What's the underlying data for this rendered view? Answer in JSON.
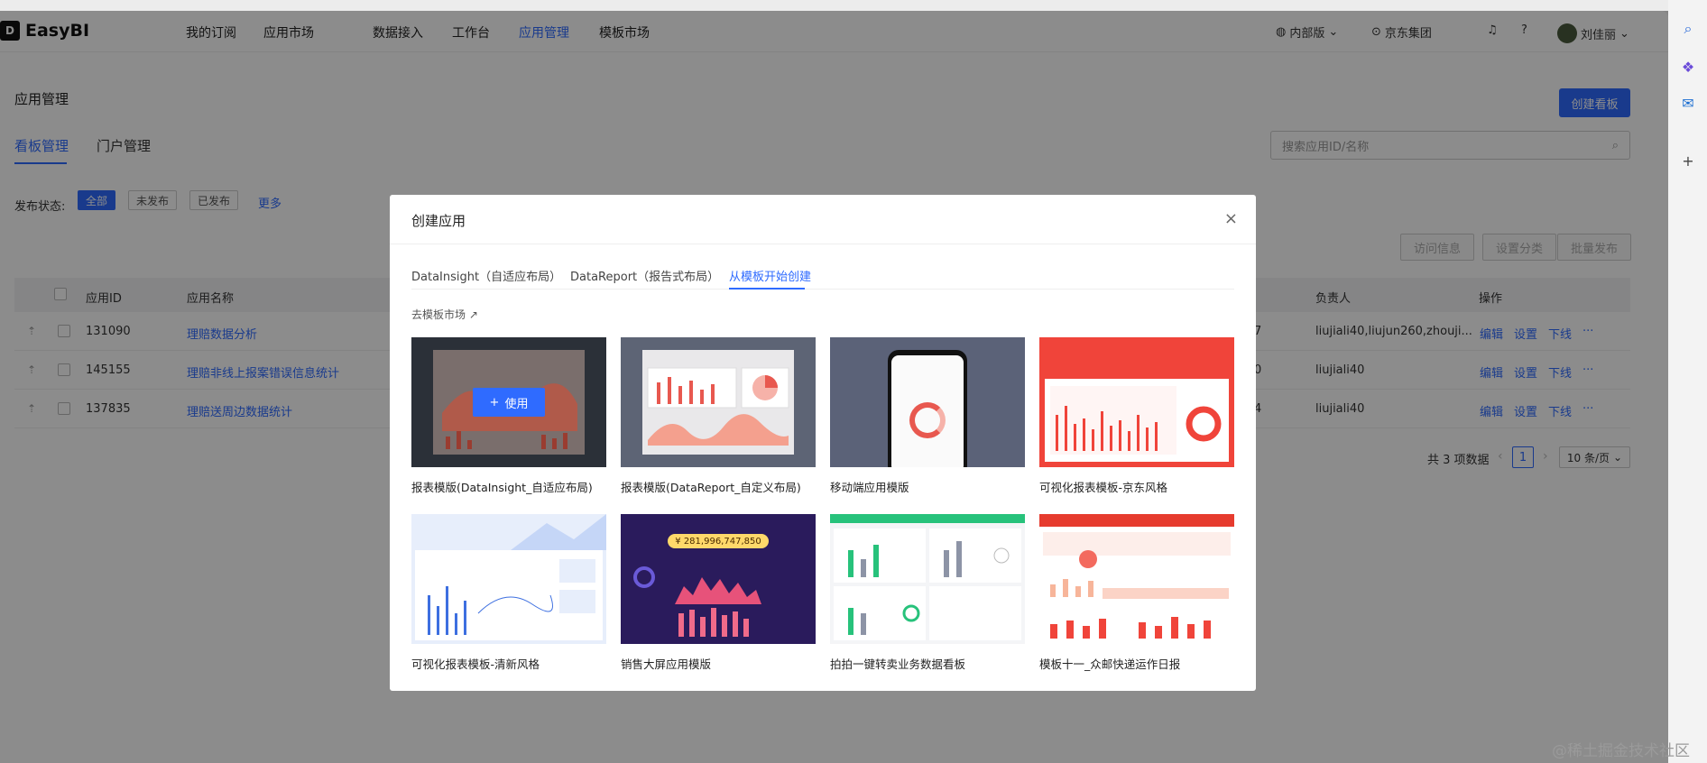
{
  "brand": "EasyBI",
  "nav": {
    "items": [
      "我的订阅",
      "应用市场",
      "数据接入",
      "工作台",
      "应用管理",
      "模板市场"
    ],
    "active": "应用管理",
    "edition": "内部版",
    "org": "京东集团",
    "user": "刘佳丽"
  },
  "page": {
    "title": "应用管理",
    "create_button": "创建看板",
    "tabs": [
      "看板管理",
      "门户管理"
    ],
    "search_placeholder": "搜索应用ID/名称",
    "filter_label": "发布状态:",
    "filters": [
      "全部",
      "未发布",
      "已发布"
    ],
    "more": "更多",
    "actions": [
      "访问信息",
      "设置分类",
      "批量发布"
    ]
  },
  "table": {
    "headers": {
      "id": "应用ID",
      "name": "应用名称",
      "owner": "负责人",
      "ops": "操作"
    },
    "rows": [
      {
        "id": "131090",
        "name": "理赔数据分析",
        "mid": "7",
        "owner": "liujiali40,liujun260,zhouji..."
      },
      {
        "id": "145155",
        "name": "理赔非线上报案错误信息统计",
        "mid": "0",
        "owner": "liujiali40"
      },
      {
        "id": "137835",
        "name": "理赔送周边数据统计",
        "mid": "4",
        "owner": "liujiali40"
      }
    ],
    "op_labels": [
      "编辑",
      "设置",
      "下线",
      "···"
    ]
  },
  "pager": {
    "total": "共 3 项数据",
    "current": "1",
    "size": "10 条/页"
  },
  "modal": {
    "title": "创建应用",
    "close": "×",
    "tabs": [
      "DataInsight（自适应布局）",
      "DataReport（报告式布局）",
      "从模板开始创建"
    ],
    "active_tab": 2,
    "market_link": "去模板市场 ↗",
    "use_button": "使用",
    "templates": [
      {
        "name": "报表模版(DataInsight_自适应布局)"
      },
      {
        "name": "报表模版(DataReport_自定义布局)"
      },
      {
        "name": "移动端应用模版"
      },
      {
        "name": "可视化报表模板-京东风格"
      },
      {
        "name": "可视化报表模板-清新风格"
      },
      {
        "name": "销售大屏应用模版"
      },
      {
        "name": "拍拍一键转卖业务数据看板"
      },
      {
        "name": "模板十一_众邮快递运作日报"
      }
    ],
    "sales_value": "¥ 281,996,747,850"
  },
  "watermark": "@稀土掘金技术社区",
  "colors": {
    "accent": "#2f6bff",
    "jd_red": "#f0443a"
  }
}
